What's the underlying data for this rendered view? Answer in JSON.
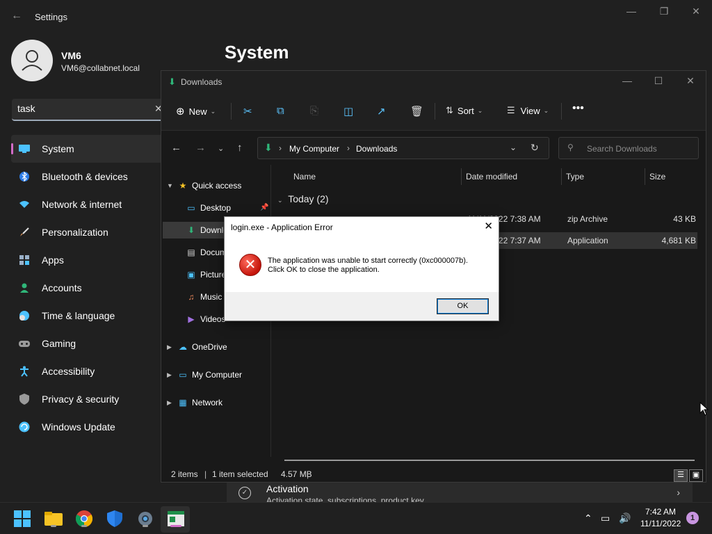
{
  "settings": {
    "title": "Settings",
    "user": {
      "name": "VM6",
      "email": "VM6@collabnet.local"
    },
    "search": {
      "value": "task"
    },
    "page_title": "System",
    "nav": [
      {
        "label": "System",
        "icon": "monitor-icon",
        "color": "#4cc2ff"
      },
      {
        "label": "Bluetooth & devices",
        "icon": "bluetooth-icon",
        "color": "#4cc2ff"
      },
      {
        "label": "Network & internet",
        "icon": "wifi-icon",
        "color": "#4cc2ff"
      },
      {
        "label": "Personalization",
        "icon": "brush-icon",
        "color": "#f4a261"
      },
      {
        "label": "Apps",
        "icon": "apps-icon",
        "color": "#9ab0c8"
      },
      {
        "label": "Accounts",
        "icon": "person-icon",
        "color": "#2fb679"
      },
      {
        "label": "Time & language",
        "icon": "clock-globe-icon",
        "color": "#4cc2ff"
      },
      {
        "label": "Gaming",
        "icon": "gamepad-icon",
        "color": "#9a9a9a"
      },
      {
        "label": "Accessibility",
        "icon": "accessibility-icon",
        "color": "#4cc2ff"
      },
      {
        "label": "Privacy & security",
        "icon": "shield-icon",
        "color": "#9a9a9a"
      },
      {
        "label": "Windows Update",
        "icon": "update-icon",
        "color": "#4cc2ff"
      }
    ],
    "activation": {
      "title": "Activation",
      "subtitle": "Activation state, subscriptions, product key"
    }
  },
  "explorer": {
    "title": "Downloads",
    "toolbar": {
      "new": "New",
      "sort": "Sort",
      "view": "View"
    },
    "breadcrumb": [
      "My Computer",
      "Downloads"
    ],
    "search_placeholder": "Search Downloads",
    "tree": [
      {
        "label": "Quick access",
        "icon": "star-icon"
      },
      {
        "label": "Desktop",
        "icon": "desktop-icon"
      },
      {
        "label": "Downloads",
        "icon": "download-icon"
      },
      {
        "label": "Documents",
        "icon": "document-icon"
      },
      {
        "label": "Pictures",
        "icon": "picture-icon"
      },
      {
        "label": "Music",
        "icon": "music-icon"
      },
      {
        "label": "Videos",
        "icon": "video-icon"
      },
      {
        "label": "OneDrive",
        "icon": "cloud-icon"
      },
      {
        "label": "My Computer",
        "icon": "computer-icon"
      },
      {
        "label": "Network",
        "icon": "network-icon"
      }
    ],
    "columns": [
      "Name",
      "Date modified",
      "Type",
      "Size"
    ],
    "group": "Today (2)",
    "files": [
      {
        "name": "",
        "date": "11/11/2022 7:38 AM",
        "type": "zip Archive",
        "size": "43 KB"
      },
      {
        "name": "",
        "date": "11/11/2022 7:37 AM",
        "type": "Application",
        "size": "4,681 KB"
      }
    ],
    "status": {
      "items": "2 items",
      "selected": "1 item selected",
      "size": "4.57 MB"
    }
  },
  "dialog": {
    "title": "login.exe - Application Error",
    "message_line1": "The application was unable to start correctly (0xc000007b).",
    "message_line2": "Click OK to close the application.",
    "ok": "OK"
  },
  "taskbar": {
    "time": "7:42 AM",
    "date": "11/11/2022",
    "notifications": "1"
  }
}
